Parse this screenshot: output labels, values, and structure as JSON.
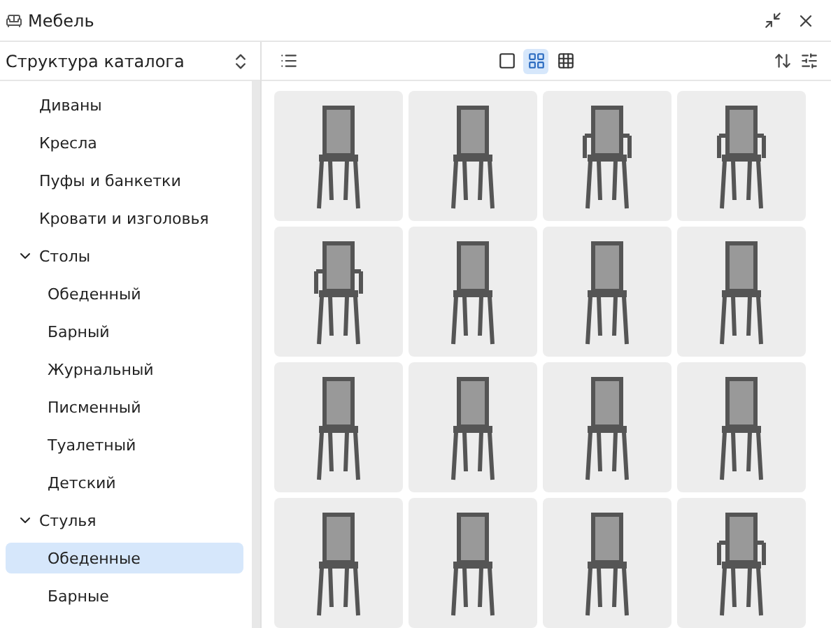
{
  "window": {
    "title": "Мебель"
  },
  "sidebar": {
    "title": "Структура каталога",
    "items": [
      {
        "label": "Диваны",
        "selected": false
      },
      {
        "label": "Кресла",
        "selected": false
      },
      {
        "label": "Пуфы и банкетки",
        "selected": false
      },
      {
        "label": "Кровати и изголовья",
        "selected": false
      },
      {
        "label": "Столы",
        "selected": false,
        "expanded": true,
        "children": [
          {
            "label": "Обеденный",
            "selected": false
          },
          {
            "label": "Барный",
            "selected": false
          },
          {
            "label": "Журнальный",
            "selected": false
          },
          {
            "label": "Писменный",
            "selected": false
          },
          {
            "label": "Туалетный",
            "selected": false
          },
          {
            "label": "Детский",
            "selected": false
          }
        ]
      },
      {
        "label": "Стулья",
        "selected": false,
        "expanded": true,
        "children": [
          {
            "label": "Обеденные",
            "selected": true
          },
          {
            "label": "Барные",
            "selected": false
          }
        ]
      }
    ]
  },
  "view_modes": [
    {
      "kind": "single",
      "selected": false
    },
    {
      "kind": "grid",
      "selected": true
    },
    {
      "kind": "dense",
      "selected": false
    }
  ],
  "products": [
    {
      "kind": "chair"
    },
    {
      "kind": "chair"
    },
    {
      "kind": "armchair"
    },
    {
      "kind": "armchair"
    },
    {
      "kind": "armchair"
    },
    {
      "kind": "chair"
    },
    {
      "kind": "chair"
    },
    {
      "kind": "chair"
    },
    {
      "kind": "chair"
    },
    {
      "kind": "chair"
    },
    {
      "kind": "chair"
    },
    {
      "kind": "chair"
    },
    {
      "kind": "chair"
    },
    {
      "kind": "chair"
    },
    {
      "kind": "chair"
    },
    {
      "kind": "armchair"
    }
  ]
}
